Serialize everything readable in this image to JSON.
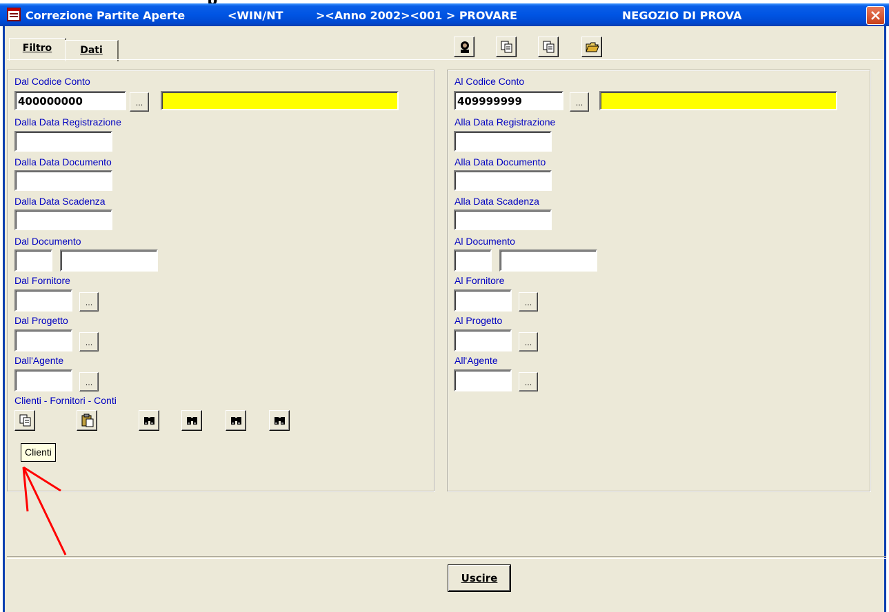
{
  "window": {
    "title_name": "Correzione Partite Aperte",
    "title_sys": "<WIN/NT",
    "title_year": "><Anno 2002><001 > PROVARE",
    "title_shop": "NEGOZIO DI PROVA"
  },
  "tabs": [
    {
      "label": "Filtro",
      "active": true
    },
    {
      "label": "Dati",
      "active": false
    }
  ],
  "toolbar_icons": [
    "person-icon",
    "copy-icon",
    "copy-icon",
    "open-folder-icon"
  ],
  "left": {
    "codice_label": "Dal Codice Conto",
    "codice_value": "400000000",
    "data_reg_label": "Dalla Data Registrazione",
    "data_doc_label": "Dalla Data Documento",
    "data_scad_label": "Dalla Data Scadenza",
    "documento_label": "Dal Documento",
    "fornitore_label": "Dal Fornitore",
    "progetto_label": "Dal Progetto",
    "agente_label": "Dall'Agente",
    "cfc_label": "Clienti - Fornitori - Conti"
  },
  "right": {
    "codice_label": "Al Codice Conto",
    "codice_value": "409999999",
    "data_reg_label": "Alla Data Registrazione",
    "data_doc_label": "Alla Data Documento",
    "data_scad_label": "Alla Data Scadenza",
    "documento_label": "Al Documento",
    "fornitore_label": "Al Fornitore",
    "progetto_label": "Al Progetto",
    "agente_label": "All'Agente"
  },
  "ellipsis": "...",
  "tooltip": "Clienti",
  "exit_label": "Uscire",
  "colors": {
    "title_bar": "#0054e3",
    "field_highlight": "#ffff00",
    "label_blue": "#0000c0",
    "annotation_arrow": "#ff0000"
  }
}
